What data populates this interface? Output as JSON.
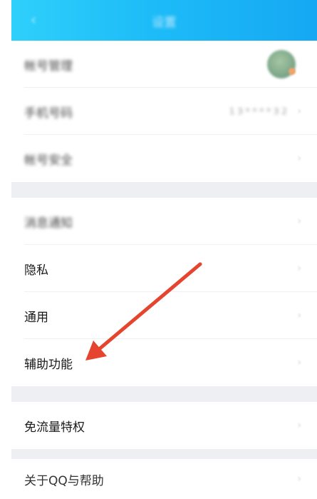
{
  "header": {
    "title": "设置",
    "back_icon": "chevron-left-icon"
  },
  "group1": {
    "items": [
      {
        "label": "帐号管理"
      },
      {
        "label": "手机号码",
        "value": "1 3 * * * * 3 2"
      },
      {
        "label": "帐号安全"
      }
    ]
  },
  "group2": {
    "items": [
      {
        "label": "消息通知"
      },
      {
        "label": "隐私"
      },
      {
        "label": "通用"
      },
      {
        "label": "辅助功能"
      }
    ]
  },
  "group3": {
    "items": [
      {
        "label": "免流量特权"
      }
    ]
  },
  "group4": {
    "items": [
      {
        "label": "关于QQ与帮助"
      }
    ]
  },
  "chevron_glyph": "›",
  "colors": {
    "header_start": "#2fd0fb",
    "header_end": "#16a8f3",
    "annotation_arrow": "#e5452f",
    "section_gap": "#eeeff3"
  }
}
